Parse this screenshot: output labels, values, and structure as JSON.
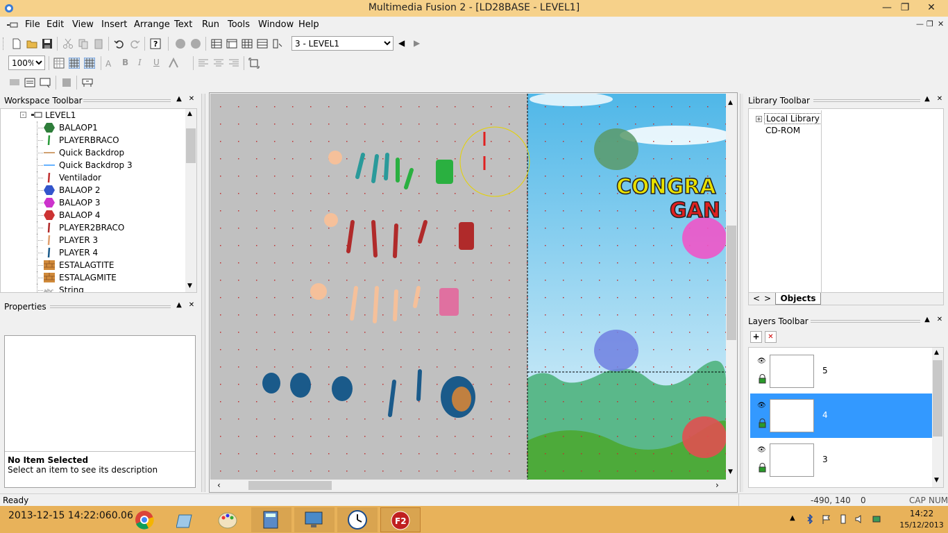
{
  "window": {
    "title": "Multimedia Fusion 2 - [LD28BASE - LEVEL1]"
  },
  "menu": [
    "File",
    "Edit",
    "View",
    "Insert",
    "Arrange",
    "Text",
    "Run",
    "Tools",
    "Window",
    "Help"
  ],
  "toolbar": {
    "frame_select": "3 - LEVEL1",
    "zoom": "100%"
  },
  "workspace": {
    "title": "Workspace Toolbar",
    "frame": "LEVEL1",
    "items": [
      {
        "label": "BALAOP1",
        "icon": "green-balloon-icon",
        "color": "#2e7d3a"
      },
      {
        "label": "PLAYERBRACO",
        "icon": "green-arm-icon",
        "color": "#2a9a3a"
      },
      {
        "label": "Quick Backdrop",
        "icon": "orange-line-icon",
        "color": "#c08040"
      },
      {
        "label": "Quick Backdrop 3",
        "icon": "blue-line-icon",
        "color": "#3399ff"
      },
      {
        "label": "Ventilador",
        "icon": "red-dash-icon",
        "color": "#c03030"
      },
      {
        "label": "BALAOP 2",
        "icon": "blue-balloon-icon",
        "color": "#3355cc"
      },
      {
        "label": "BALAOP 3",
        "icon": "magenta-balloon-icon",
        "color": "#cc33cc"
      },
      {
        "label": "BALAOP 4",
        "icon": "red-balloon-icon",
        "color": "#cc3333"
      },
      {
        "label": "PLAYER2BRACO",
        "icon": "red-arm-icon",
        "color": "#b02a2a"
      },
      {
        "label": "PLAYER 3",
        "icon": "skin-arm-icon",
        "color": "#e0a070"
      },
      {
        "label": "PLAYER 4",
        "icon": "blue-leg-icon",
        "color": "#1a5a8a"
      },
      {
        "label": "ESTALAGTITE",
        "icon": "brick-icon",
        "color": "#d08a3a"
      },
      {
        "label": "ESTALAGMITE",
        "icon": "brick-icon",
        "color": "#d08a3a"
      },
      {
        "label": "String",
        "icon": "abc-icon",
        "color": "#666666"
      }
    ]
  },
  "properties": {
    "title": "Properties",
    "heading": "No Item Selected",
    "description": "Select an item to see its description"
  },
  "editor": {
    "congrats_line1": "CONGRA",
    "congrats_line2": "GAN"
  },
  "library": {
    "title": "Library Toolbar",
    "items": [
      "Local Library",
      "CD-ROM"
    ],
    "tab": "Objects"
  },
  "layers": {
    "title": "Layers Toolbar",
    "rows": [
      {
        "name": "5",
        "selected": false
      },
      {
        "name": "4",
        "selected": true
      },
      {
        "name": "3",
        "selected": false
      }
    ]
  },
  "status": {
    "left": "Ready",
    "coords": "-490, 140",
    "value": "0",
    "caps": "CAP",
    "num": "NUM"
  },
  "taskbar": {
    "overlay_text": "2013-12-15 14:22:060.06",
    "time": "14:22",
    "date": "15/12/2013"
  }
}
